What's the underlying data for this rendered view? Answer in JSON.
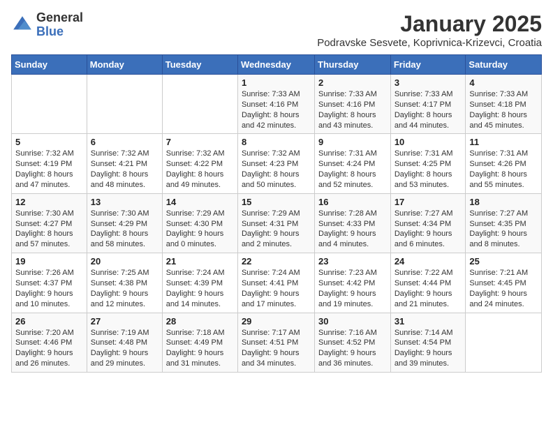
{
  "logo": {
    "general": "General",
    "blue": "Blue"
  },
  "title": "January 2025",
  "subtitle": "Podravske Sesvete, Koprivnica-Krizevci, Croatia",
  "days_of_week": [
    "Sunday",
    "Monday",
    "Tuesday",
    "Wednesday",
    "Thursday",
    "Friday",
    "Saturday"
  ],
  "weeks": [
    [
      {
        "day": "",
        "info": ""
      },
      {
        "day": "",
        "info": ""
      },
      {
        "day": "",
        "info": ""
      },
      {
        "day": "1",
        "info": "Sunrise: 7:33 AM\nSunset: 4:16 PM\nDaylight: 8 hours and 42 minutes."
      },
      {
        "day": "2",
        "info": "Sunrise: 7:33 AM\nSunset: 4:16 PM\nDaylight: 8 hours and 43 minutes."
      },
      {
        "day": "3",
        "info": "Sunrise: 7:33 AM\nSunset: 4:17 PM\nDaylight: 8 hours and 44 minutes."
      },
      {
        "day": "4",
        "info": "Sunrise: 7:33 AM\nSunset: 4:18 PM\nDaylight: 8 hours and 45 minutes."
      }
    ],
    [
      {
        "day": "5",
        "info": "Sunrise: 7:32 AM\nSunset: 4:19 PM\nDaylight: 8 hours and 47 minutes."
      },
      {
        "day": "6",
        "info": "Sunrise: 7:32 AM\nSunset: 4:21 PM\nDaylight: 8 hours and 48 minutes."
      },
      {
        "day": "7",
        "info": "Sunrise: 7:32 AM\nSunset: 4:22 PM\nDaylight: 8 hours and 49 minutes."
      },
      {
        "day": "8",
        "info": "Sunrise: 7:32 AM\nSunset: 4:23 PM\nDaylight: 8 hours and 50 minutes."
      },
      {
        "day": "9",
        "info": "Sunrise: 7:31 AM\nSunset: 4:24 PM\nDaylight: 8 hours and 52 minutes."
      },
      {
        "day": "10",
        "info": "Sunrise: 7:31 AM\nSunset: 4:25 PM\nDaylight: 8 hours and 53 minutes."
      },
      {
        "day": "11",
        "info": "Sunrise: 7:31 AM\nSunset: 4:26 PM\nDaylight: 8 hours and 55 minutes."
      }
    ],
    [
      {
        "day": "12",
        "info": "Sunrise: 7:30 AM\nSunset: 4:27 PM\nDaylight: 8 hours and 57 minutes."
      },
      {
        "day": "13",
        "info": "Sunrise: 7:30 AM\nSunset: 4:29 PM\nDaylight: 8 hours and 58 minutes."
      },
      {
        "day": "14",
        "info": "Sunrise: 7:29 AM\nSunset: 4:30 PM\nDaylight: 9 hours and 0 minutes."
      },
      {
        "day": "15",
        "info": "Sunrise: 7:29 AM\nSunset: 4:31 PM\nDaylight: 9 hours and 2 minutes."
      },
      {
        "day": "16",
        "info": "Sunrise: 7:28 AM\nSunset: 4:33 PM\nDaylight: 9 hours and 4 minutes."
      },
      {
        "day": "17",
        "info": "Sunrise: 7:27 AM\nSunset: 4:34 PM\nDaylight: 9 hours and 6 minutes."
      },
      {
        "day": "18",
        "info": "Sunrise: 7:27 AM\nSunset: 4:35 PM\nDaylight: 9 hours and 8 minutes."
      }
    ],
    [
      {
        "day": "19",
        "info": "Sunrise: 7:26 AM\nSunset: 4:37 PM\nDaylight: 9 hours and 10 minutes."
      },
      {
        "day": "20",
        "info": "Sunrise: 7:25 AM\nSunset: 4:38 PM\nDaylight: 9 hours and 12 minutes."
      },
      {
        "day": "21",
        "info": "Sunrise: 7:24 AM\nSunset: 4:39 PM\nDaylight: 9 hours and 14 minutes."
      },
      {
        "day": "22",
        "info": "Sunrise: 7:24 AM\nSunset: 4:41 PM\nDaylight: 9 hours and 17 minutes."
      },
      {
        "day": "23",
        "info": "Sunrise: 7:23 AM\nSunset: 4:42 PM\nDaylight: 9 hours and 19 minutes."
      },
      {
        "day": "24",
        "info": "Sunrise: 7:22 AM\nSunset: 4:44 PM\nDaylight: 9 hours and 21 minutes."
      },
      {
        "day": "25",
        "info": "Sunrise: 7:21 AM\nSunset: 4:45 PM\nDaylight: 9 hours and 24 minutes."
      }
    ],
    [
      {
        "day": "26",
        "info": "Sunrise: 7:20 AM\nSunset: 4:46 PM\nDaylight: 9 hours and 26 minutes."
      },
      {
        "day": "27",
        "info": "Sunrise: 7:19 AM\nSunset: 4:48 PM\nDaylight: 9 hours and 29 minutes."
      },
      {
        "day": "28",
        "info": "Sunrise: 7:18 AM\nSunset: 4:49 PM\nDaylight: 9 hours and 31 minutes."
      },
      {
        "day": "29",
        "info": "Sunrise: 7:17 AM\nSunset: 4:51 PM\nDaylight: 9 hours and 34 minutes."
      },
      {
        "day": "30",
        "info": "Sunrise: 7:16 AM\nSunset: 4:52 PM\nDaylight: 9 hours and 36 minutes."
      },
      {
        "day": "31",
        "info": "Sunrise: 7:14 AM\nSunset: 4:54 PM\nDaylight: 9 hours and 39 minutes."
      },
      {
        "day": "",
        "info": ""
      }
    ]
  ]
}
